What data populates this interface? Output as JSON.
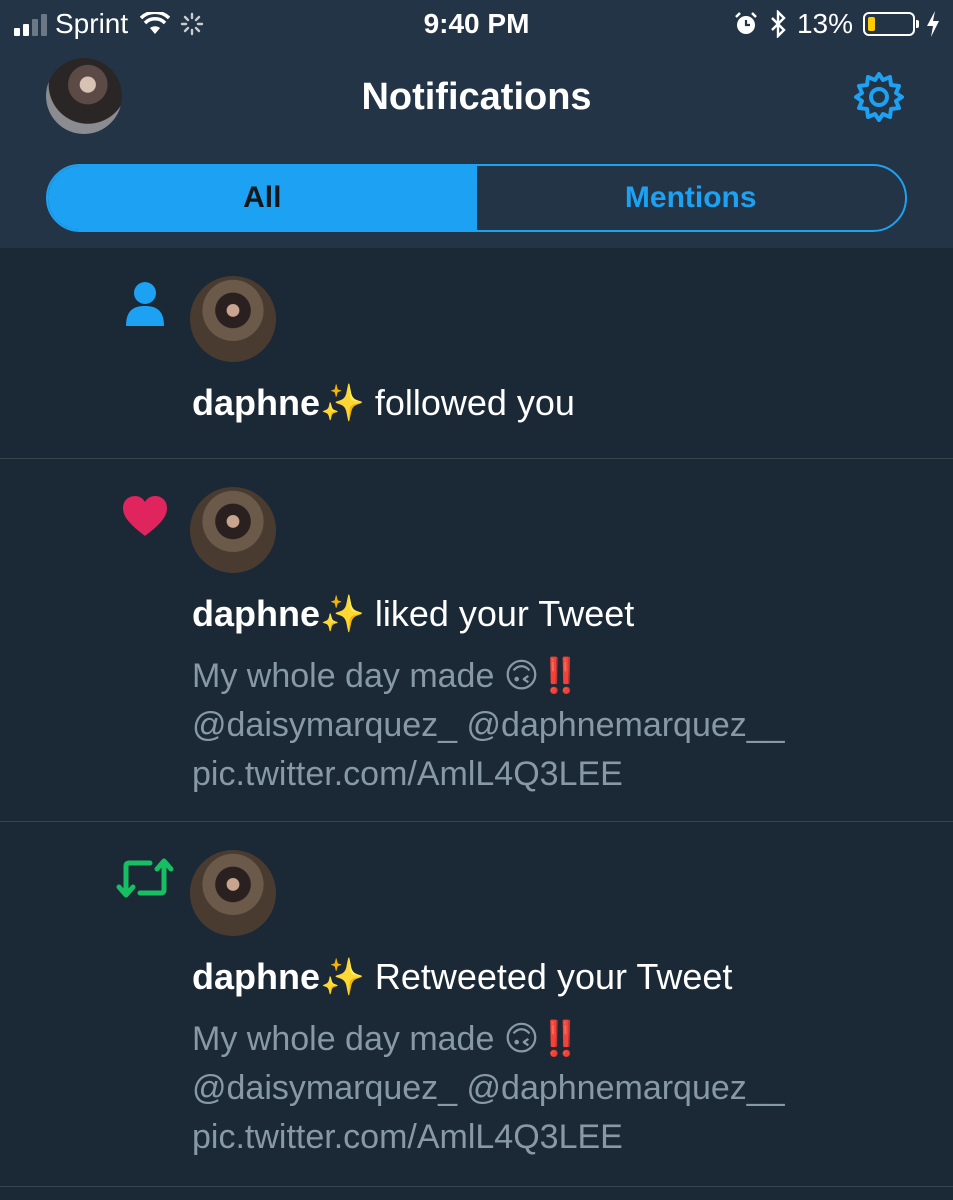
{
  "status_bar": {
    "carrier": "Sprint",
    "time": "9:40 PM",
    "battery": "13%"
  },
  "header": {
    "title": "Notifications"
  },
  "tabs": [
    {
      "label": "All",
      "active": true
    },
    {
      "label": "Mentions",
      "active": false
    }
  ],
  "notifications": [
    {
      "type": "follow",
      "icon": "person-icon",
      "name": "daphne✨",
      "action": " followed you",
      "tweet": []
    },
    {
      "type": "like",
      "icon": "heart-icon",
      "name": "daphne✨",
      "action": " liked your Tweet",
      "tweet": [
        "My whole day made 🙃‼️",
        "@daisymarquez_ @daphnemarquez__",
        "pic.twitter.com/AmlL4Q3LEE"
      ]
    },
    {
      "type": "retweet",
      "icon": "retweet-icon",
      "name": "daphne✨",
      "action": " Retweeted your Tweet",
      "tweet": [
        "My whole day made 🙃‼️",
        "@daisymarquez_ @daphnemarquez__",
        "pic.twitter.com/AmlL4Q3LEE"
      ]
    }
  ],
  "colors": {
    "accent": "#1da1f2",
    "like": "#e0245e",
    "retweet": "#17bf63",
    "background": "#1b2836",
    "header": "#243447"
  }
}
